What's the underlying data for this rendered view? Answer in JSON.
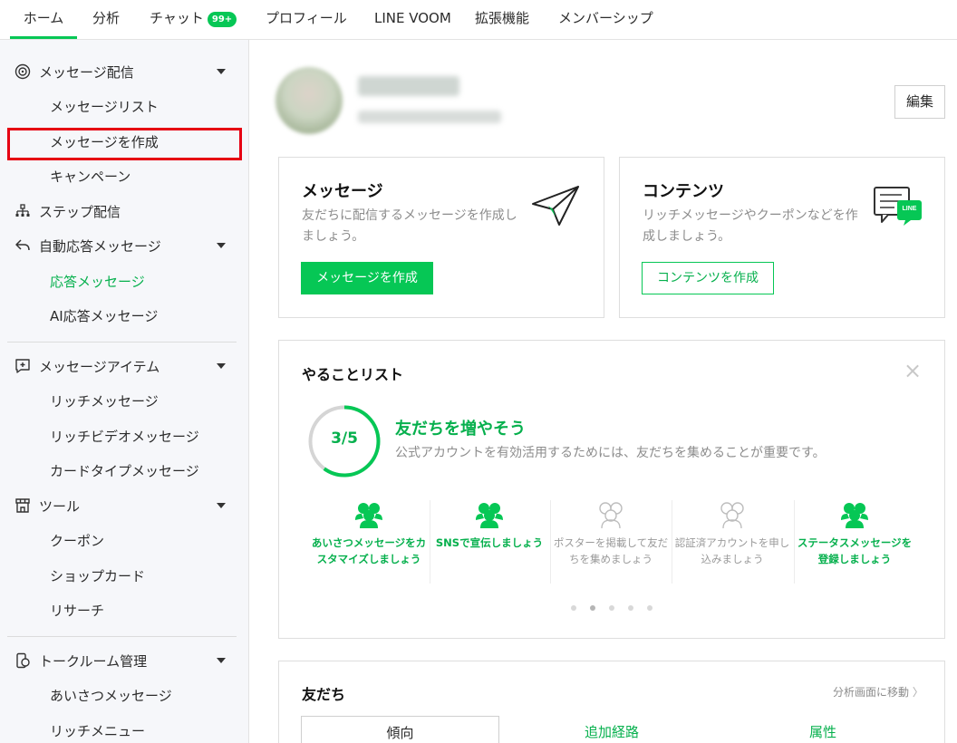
{
  "top_tabs": [
    {
      "label": "ホーム",
      "active": true
    },
    {
      "label": "分析"
    },
    {
      "label": "チャット",
      "badge": "99+"
    },
    {
      "label": "プロフィール"
    },
    {
      "label": "LINE VOOM"
    },
    {
      "label": "拡張機能"
    },
    {
      "label": "メンバーシップ"
    }
  ],
  "sidebar": {
    "message_delivery": {
      "label": "メッセージ配信",
      "icon": "broadcast-icon"
    },
    "message_list": "メッセージリスト",
    "create_message": "メッセージを作成",
    "campaign": "キャンペーン",
    "step_delivery": {
      "label": "ステップ配信",
      "icon": "flow-icon"
    },
    "auto_reply": {
      "label": "自動応答メッセージ",
      "icon": "reply-icon"
    },
    "response_message": "応答メッセージ",
    "ai_response": "AI応答メッセージ",
    "message_items": {
      "label": "メッセージアイテム",
      "icon": "message-plus-icon"
    },
    "rich_message": "リッチメッセージ",
    "rich_video": "リッチビデオメッセージ",
    "card_type": "カードタイプメッセージ",
    "tools": {
      "label": "ツール",
      "icon": "shop-icon"
    },
    "coupon": "クーポン",
    "shop_card": "ショップカード",
    "research": "リサーチ",
    "talk_room": {
      "label": "トークルーム管理",
      "icon": "phone-chat-icon"
    },
    "greeting": "あいさつメッセージ",
    "rich_menu": "リッチメニュー"
  },
  "profile": {
    "edit_label": "編集"
  },
  "cards": {
    "message": {
      "title": "メッセージ",
      "desc": "友だちに配信するメッセージを作成しましょう。",
      "button": "メッセージを作成"
    },
    "contents": {
      "title": "コンテンツ",
      "desc": "リッチメッセージやクーポンなどを作成しましょう。",
      "button": "コンテンツを作成",
      "line_badge": "LINE"
    }
  },
  "todo": {
    "title": "やることリスト",
    "close": "×",
    "progress_text": "3/5",
    "progress": 0.6,
    "goal_title": "友だちを増やそう",
    "goal_desc": "公式アカウントを有効活用するためには、友だちを集めることが重要です。",
    "tasks": [
      {
        "label": "あいさつメッセージをカスタマイズしましょう",
        "done": true
      },
      {
        "label": "SNSで宣伝しましょう",
        "done": true
      },
      {
        "label": "ポスターを掲載して友だちを集めましょう",
        "done": false
      },
      {
        "label": "認証済アカウントを申し込みましょう",
        "done": false
      },
      {
        "label": "ステータスメッセージを登録しましょう",
        "done": true
      }
    ]
  },
  "friends": {
    "title": "友だち",
    "link": "分析画面に移動",
    "tabs": [
      "傾向",
      "追加経路",
      "属性"
    ]
  }
}
